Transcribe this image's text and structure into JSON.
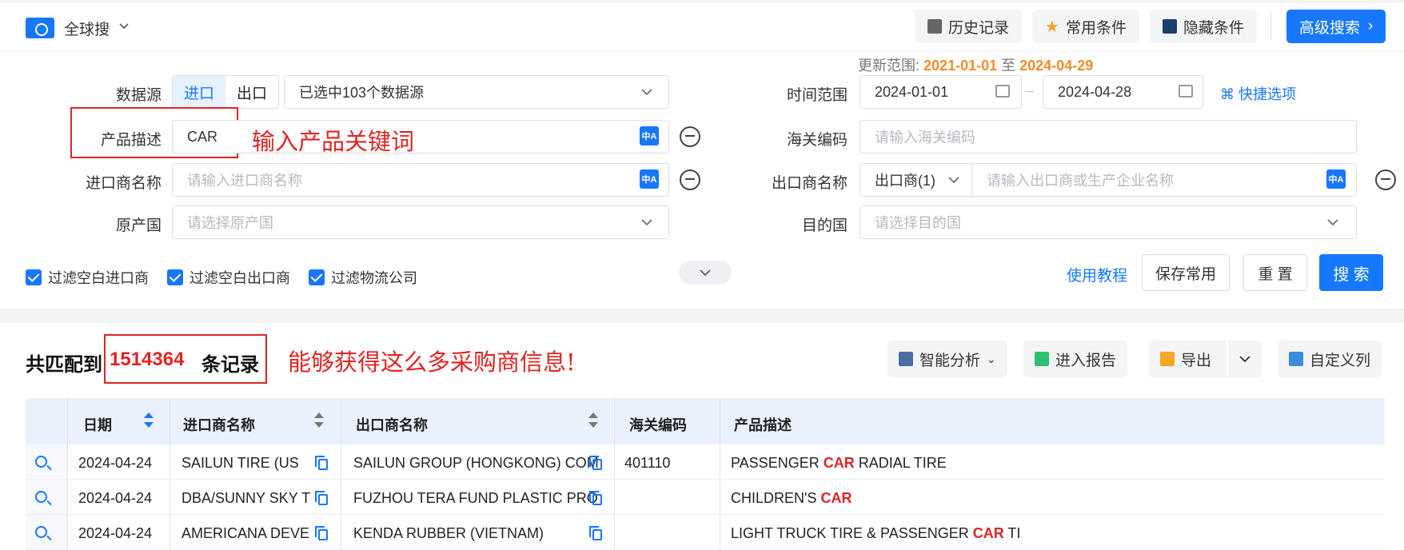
{
  "topbar": {
    "scope": "全球搜",
    "history": "历史记录",
    "favorites": "常用条件",
    "hide": "隐藏条件",
    "advanced": "高级搜索"
  },
  "form": {
    "datasource_label": "数据源",
    "import_tab": "进口",
    "export_tab": "出口",
    "datasource_value": "已选中103个数据源",
    "update_range_label": "更新范围:",
    "update_from": "2021-01-01",
    "update_to_word": "至",
    "update_to": "2024-04-29",
    "time_label": "时间范围",
    "date_start": "2024-01-01",
    "date_end": "2024-04-28",
    "quick_options": "快捷选项",
    "product_label": "产品描述",
    "product_value": "CAR",
    "hs_label": "海关编码",
    "hs_placeholder": "请输入海关编码",
    "importer_label": "进口商名称",
    "importer_placeholder": "请输入进口商名称",
    "exporter_label": "出口商名称",
    "exporter_type": "出口商(1)",
    "exporter_placeholder": "请输入出口商或生产企业名称",
    "origin_label": "原产国",
    "origin_placeholder": "请选择原产国",
    "dest_label": "目的国",
    "dest_placeholder": "请选择目的国",
    "filter1": "过滤空白进口商",
    "filter2": "过滤空白出口商",
    "filter3": "过滤物流公司",
    "tutorial": "使用教程",
    "save_common": "保存常用",
    "reset": "重 置",
    "search": "搜 索",
    "annotation_keyword": "输入产品关键词"
  },
  "results": {
    "count_prefix": "共匹配到",
    "count": "1514364",
    "count_suffix": "条记录",
    "annotation": "能够获得这么多采购商信息!",
    "smart_analysis": "智能分析",
    "enter_report": "进入报告",
    "export": "导出",
    "custom_columns": "自定义列",
    "columns": [
      "日期",
      "进口商名称",
      "出口商名称",
      "海关编码",
      "产品描述"
    ],
    "rows": [
      {
        "date": "2024-04-24",
        "importer": "SAILUN TIRE (US",
        "exporter": "SAILUN GROUP (HONGKONG) COM",
        "hs": "401110",
        "desc_pre": "PASSENGER ",
        "desc_hl": "CAR",
        "desc_post": " RADIAL TIRE"
      },
      {
        "date": "2024-04-24",
        "importer": "DBA/SUNNY SKY T",
        "exporter": "FUZHOU TERA FUND PLASTIC PRO",
        "hs": "",
        "desc_pre": "CHILDREN'S ",
        "desc_hl": "CAR",
        "desc_post": ""
      },
      {
        "date": "2024-04-24",
        "importer": "AMERICANA DEVE",
        "exporter": "KENDA RUBBER (VIETNAM)",
        "hs": "",
        "desc_pre": "LIGHT TRUCK TIRE & PASSENGER ",
        "desc_hl": "CAR",
        "desc_post": " TI"
      }
    ]
  },
  "colors": {
    "accent": "#1677ff",
    "highlight": "#e02424",
    "range": "#f08c2a"
  }
}
